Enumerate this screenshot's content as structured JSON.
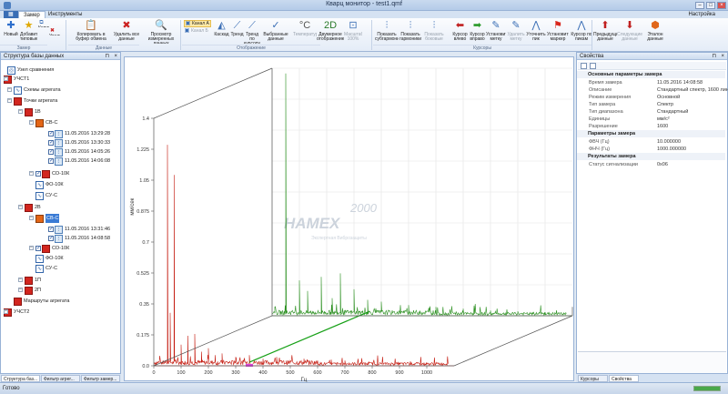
{
  "window": {
    "title": "Кварц монитор - test1.qmf"
  },
  "ribbon_tabs": [
    "Замер",
    "Инструменты"
  ],
  "settings_label": "Настройка",
  "ribbon": {
    "buttons": [
      {
        "label": "Новый",
        "icon": "new-icon"
      },
      {
        "label": "Добавить типовые",
        "icon": "star-icon"
      },
      {
        "label": "Копировать",
        "icon": "copy-icon"
      },
      {
        "label": "Удалить",
        "icon": "delete-icon"
      },
      {
        "label": "Копировать в буфер обмена",
        "icon": "clipboard-icon"
      },
      {
        "label": "Удалить все данные",
        "icon": "delete-all-icon"
      },
      {
        "label": "Просмотр измеренных данных",
        "icon": "magnifier-icon"
      },
      {
        "label": "Канал А",
        "icon": "channel-a-icon"
      },
      {
        "label": "Канал Б",
        "icon": "channel-b-icon"
      },
      {
        "label": "Каскад",
        "icon": "cascade-icon"
      },
      {
        "label": "Тренд",
        "icon": "trend-icon"
      },
      {
        "label": "Тренд по курсору",
        "icon": "trend-cursor-icon"
      },
      {
        "label": "Выбранные данные",
        "icon": "selected-data-icon"
      },
      {
        "label": "Температура",
        "icon": "temperature-icon"
      },
      {
        "label": "Двумерное отображение",
        "icon": "2d-icon"
      },
      {
        "label": "Масштаб 100%",
        "icon": "scale-icon"
      },
      {
        "label": "Показать субгармоники",
        "icon": "subharmonics-icon"
      },
      {
        "label": "Показать гармоники",
        "icon": "harmonics-icon"
      },
      {
        "label": "Показать боковые",
        "icon": "sidebands-icon"
      },
      {
        "label": "Курсор влево",
        "icon": "arrow-left-icon"
      },
      {
        "label": "Курсор вправо",
        "icon": "arrow-right-icon"
      },
      {
        "label": "Установить метку",
        "icon": "set-marker-icon"
      },
      {
        "label": "Удалить метку",
        "icon": "remove-marker-icon"
      },
      {
        "label": "Уточнить пик",
        "icon": "refine-peak-icon"
      },
      {
        "label": "Установить маркер",
        "icon": "flag-icon"
      },
      {
        "label": "Курсор по пикам",
        "icon": "peak-cursor-icon"
      },
      {
        "label": "Предыдущие данные",
        "icon": "prev-data-icon"
      },
      {
        "label": "Следующие данные",
        "icon": "next-data-icon"
      },
      {
        "label": "Эталон данные",
        "icon": "reference-icon"
      }
    ],
    "groups": [
      "Замер",
      "Данные",
      "Отображение",
      "Курсоры"
    ]
  },
  "left_panel": {
    "title": "Структура базы данных",
    "tree": [
      {
        "label": "Узел сравнения",
        "kind": "node"
      },
      {
        "label": "УЧСТ1",
        "kind": "red"
      },
      {
        "label": "Схемы агрегата",
        "kind": "blue"
      },
      {
        "label": "Точки агрегата",
        "kind": "red"
      },
      {
        "label": "1В",
        "kind": "red"
      },
      {
        "label": "СВ-С",
        "kind": "orange"
      },
      {
        "label": "11.05.2016 13:29:28",
        "kind": "spec"
      },
      {
        "label": "11.05.2016 13:30:33",
        "kind": "spec"
      },
      {
        "label": "11.05.2016 14:05:26",
        "kind": "spec"
      },
      {
        "label": "11.05.2016 14:06:08",
        "kind": "spec"
      },
      {
        "label": "СО-10К",
        "kind": "red"
      },
      {
        "label": "ФО-10К",
        "kind": "blue"
      },
      {
        "label": "СУ-С",
        "kind": "blue"
      },
      {
        "label": "2В",
        "kind": "red"
      },
      {
        "label": "СВ-С",
        "kind": "orange"
      },
      {
        "label": "11.05.2016 13:31:46",
        "kind": "spec"
      },
      {
        "label": "11.05.2016 14:08:58",
        "kind": "spec"
      },
      {
        "label": "СО-10К",
        "kind": "red"
      },
      {
        "label": "ФО-10К",
        "kind": "blue"
      },
      {
        "label": "СУ-С",
        "kind": "blue"
      },
      {
        "label": "1П",
        "kind": "red"
      },
      {
        "label": "2П",
        "kind": "red"
      },
      {
        "label": "Маршруты агрегата",
        "kind": "red"
      },
      {
        "label": "УЧСТ2",
        "kind": "red"
      }
    ],
    "bottom_tabs": [
      "Структура баз...",
      "Фильтр агрег...",
      "Фильтр замер..."
    ]
  },
  "chart_data": {
    "type": "line",
    "title": "",
    "xlabel": "Гц",
    "ylabel": "мм/сек",
    "xticks": [
      0,
      100,
      200,
      300,
      400,
      500,
      600,
      700,
      800,
      900,
      1000
    ],
    "yticks": [
      0.0,
      0.175,
      0.35,
      0.525,
      0.7,
      0.875,
      1.05,
      1.225,
      1.4
    ],
    "xlim": [
      0,
      1100
    ],
    "ylim": [
      0,
      1.4
    ],
    "watermark": {
      "number": "2000",
      "brand": "HAMEX",
      "tagline": "Экспертная Виброзащиты"
    },
    "series": [
      {
        "color": "#c41a0f",
        "depth": 0,
        "peaks": [
          [
            25,
            0.02
          ],
          [
            50,
            1.25
          ],
          [
            60,
            0.3
          ],
          [
            75,
            1.08
          ],
          [
            100,
            0.12
          ],
          [
            125,
            0.17
          ],
          [
            150,
            0.18
          ],
          [
            175,
            0.08
          ],
          [
            200,
            0.1
          ],
          [
            225,
            0.06
          ],
          [
            250,
            0.07
          ],
          [
            300,
            0.05
          ],
          [
            350,
            0.06
          ],
          [
            400,
            0.04
          ],
          [
            450,
            0.05
          ],
          [
            500,
            0.03
          ],
          [
            550,
            0.04
          ],
          [
            600,
            0.03
          ],
          [
            650,
            0.035
          ],
          [
            700,
            0.03
          ],
          [
            800,
            0.02
          ],
          [
            900,
            0.015
          ],
          [
            1000,
            0.01
          ]
        ]
      },
      {
        "color": "#2a8f1f",
        "depth": 1,
        "peaks": [
          [
            10,
            0.05
          ],
          [
            50,
            1.37
          ],
          [
            100,
            0.2
          ],
          [
            130,
            0.14
          ],
          [
            180,
            0.22
          ],
          [
            220,
            0.1
          ],
          [
            250,
            0.24
          ],
          [
            300,
            0.15
          ],
          [
            350,
            0.09
          ],
          [
            400,
            0.08
          ],
          [
            500,
            0.06
          ],
          [
            600,
            0.05
          ],
          [
            700,
            0.04
          ],
          [
            800,
            0.03
          ],
          [
            900,
            0.025
          ],
          [
            1000,
            0.02
          ]
        ]
      }
    ]
  },
  "right_panel": {
    "title": "Свойства",
    "sections": [
      {
        "name": "Основные параметры замера",
        "rows": [
          {
            "k": "Время замера",
            "v": "11.05.2016 14:08:58"
          },
          {
            "k": "Описание",
            "v": "Стандартный спектр, 1600 линий"
          },
          {
            "k": "Режим измерения",
            "v": "Основной"
          },
          {
            "k": "Тип замера",
            "v": "Спектр"
          },
          {
            "k": "Тип диапазона",
            "v": "Стандартный"
          },
          {
            "k": "Единицы",
            "v": "мм/с²"
          },
          {
            "k": "Разрешение",
            "v": "1600"
          }
        ]
      },
      {
        "name": "Параметры замера",
        "rows": [
          {
            "k": "ФВЧ (Гц)",
            "v": "10.000000"
          },
          {
            "k": "ФНЧ (Гц)",
            "v": "1000.000000"
          }
        ]
      },
      {
        "name": "Результаты замера",
        "rows": [
          {
            "k": "Статус сигнализации",
            "v": "0x06"
          }
        ]
      }
    ],
    "bottom_tabs": [
      "Курсоры",
      "Свойства"
    ]
  },
  "status": {
    "text": "Готово",
    "progress": 1.0
  }
}
